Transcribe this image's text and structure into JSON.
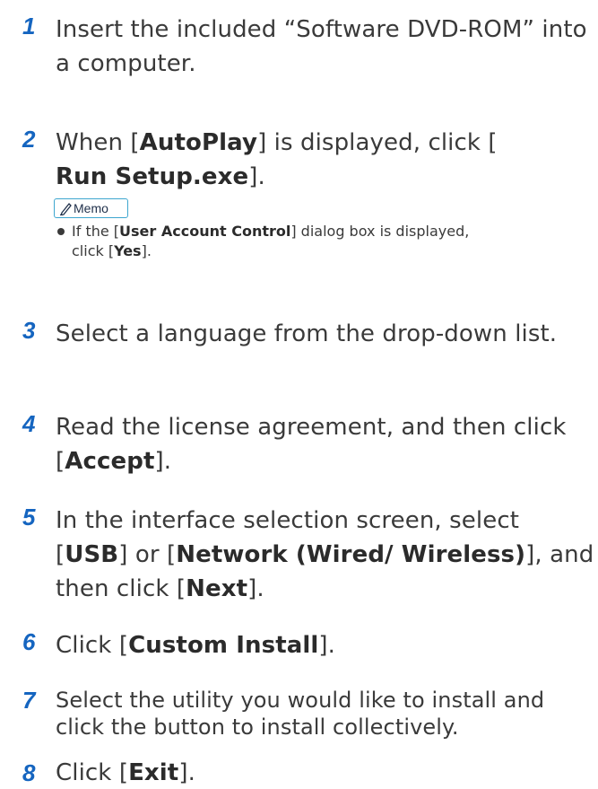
{
  "steps": [
    {
      "number": "1",
      "parts": [
        "Insert the included “Software DVD-ROM” into a computer."
      ]
    },
    {
      "number": "2",
      "parts": [
        "When [",
        "AutoPlay",
        "] is displayed, click [",
        "Run Setup.exe",
        "]."
      ]
    },
    {
      "number": "3",
      "parts": [
        "Select a language from the drop-down list."
      ]
    },
    {
      "number": "4",
      "parts": [
        "Read the license agreement, and then click [",
        "Accept",
        "]."
      ]
    },
    {
      "number": "5",
      "parts": [
        "In the interface selection screen, select [",
        "USB",
        "] or [",
        "Network (Wired/ Wireless)",
        "], and then click [",
        "Next",
        "]."
      ]
    },
    {
      "number": "6",
      "parts": [
        "Click [",
        "Custom Install",
        "]."
      ]
    },
    {
      "number": "7",
      "parts": [
        "Select the utility you would like to install and click the button to install collectively."
      ]
    },
    {
      "number": "8",
      "parts": [
        "Click [",
        "Exit",
        "]."
      ]
    }
  ],
  "memo": {
    "label": "Memo",
    "icon": "pencil-icon",
    "accent_color": "#3ea6cf",
    "parts": [
      "If the [",
      "User Account Control",
      "] dialog box is displayed, click [",
      "Yes",
      "]."
    ]
  },
  "colors": {
    "step_number": "#1565c0",
    "body_text": "#3a3a3a"
  }
}
